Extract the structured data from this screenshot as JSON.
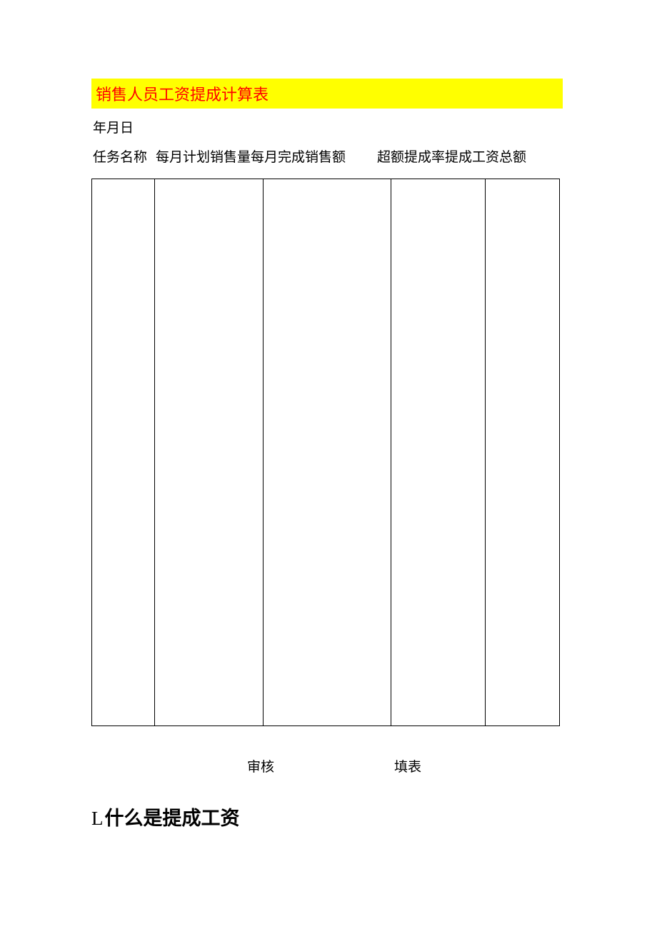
{
  "title": "销售人员工资提成计算表",
  "date_line": "年月日",
  "headers": {
    "col1": "任务名称",
    "col2": "每月计划销售量每月完成销售额",
    "col3": "超额提成率提成工资总额"
  },
  "signatures": {
    "audit": "审核",
    "fill": "填表"
  },
  "section": {
    "prefix": "L",
    "text": "什么是提成工资"
  }
}
